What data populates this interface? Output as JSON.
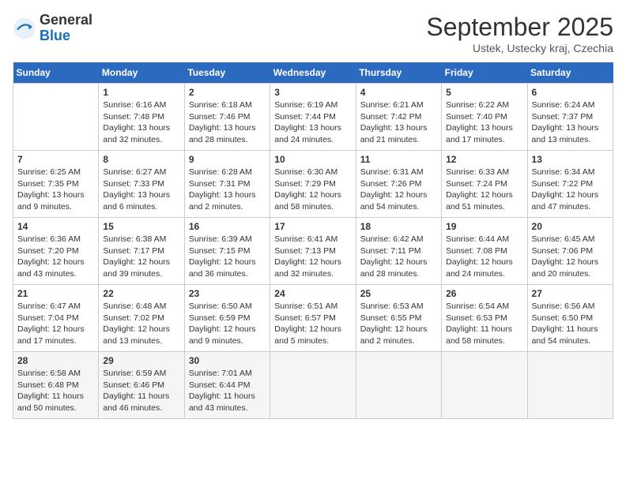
{
  "header": {
    "logo_general": "General",
    "logo_blue": "Blue",
    "month_title": "September 2025",
    "location": "Ustek, Ustecky kraj, Czechia"
  },
  "days_of_week": [
    "Sunday",
    "Monday",
    "Tuesday",
    "Wednesday",
    "Thursday",
    "Friday",
    "Saturday"
  ],
  "weeks": [
    [
      {
        "day": "",
        "info": ""
      },
      {
        "day": "1",
        "info": "Sunrise: 6:16 AM\nSunset: 7:48 PM\nDaylight: 13 hours\nand 32 minutes."
      },
      {
        "day": "2",
        "info": "Sunrise: 6:18 AM\nSunset: 7:46 PM\nDaylight: 13 hours\nand 28 minutes."
      },
      {
        "day": "3",
        "info": "Sunrise: 6:19 AM\nSunset: 7:44 PM\nDaylight: 13 hours\nand 24 minutes."
      },
      {
        "day": "4",
        "info": "Sunrise: 6:21 AM\nSunset: 7:42 PM\nDaylight: 13 hours\nand 21 minutes."
      },
      {
        "day": "5",
        "info": "Sunrise: 6:22 AM\nSunset: 7:40 PM\nDaylight: 13 hours\nand 17 minutes."
      },
      {
        "day": "6",
        "info": "Sunrise: 6:24 AM\nSunset: 7:37 PM\nDaylight: 13 hours\nand 13 minutes."
      }
    ],
    [
      {
        "day": "7",
        "info": "Sunrise: 6:25 AM\nSunset: 7:35 PM\nDaylight: 13 hours\nand 9 minutes."
      },
      {
        "day": "8",
        "info": "Sunrise: 6:27 AM\nSunset: 7:33 PM\nDaylight: 13 hours\nand 6 minutes."
      },
      {
        "day": "9",
        "info": "Sunrise: 6:28 AM\nSunset: 7:31 PM\nDaylight: 13 hours\nand 2 minutes."
      },
      {
        "day": "10",
        "info": "Sunrise: 6:30 AM\nSunset: 7:29 PM\nDaylight: 12 hours\nand 58 minutes."
      },
      {
        "day": "11",
        "info": "Sunrise: 6:31 AM\nSunset: 7:26 PM\nDaylight: 12 hours\nand 54 minutes."
      },
      {
        "day": "12",
        "info": "Sunrise: 6:33 AM\nSunset: 7:24 PM\nDaylight: 12 hours\nand 51 minutes."
      },
      {
        "day": "13",
        "info": "Sunrise: 6:34 AM\nSunset: 7:22 PM\nDaylight: 12 hours\nand 47 minutes."
      }
    ],
    [
      {
        "day": "14",
        "info": "Sunrise: 6:36 AM\nSunset: 7:20 PM\nDaylight: 12 hours\nand 43 minutes."
      },
      {
        "day": "15",
        "info": "Sunrise: 6:38 AM\nSunset: 7:17 PM\nDaylight: 12 hours\nand 39 minutes."
      },
      {
        "day": "16",
        "info": "Sunrise: 6:39 AM\nSunset: 7:15 PM\nDaylight: 12 hours\nand 36 minutes."
      },
      {
        "day": "17",
        "info": "Sunrise: 6:41 AM\nSunset: 7:13 PM\nDaylight: 12 hours\nand 32 minutes."
      },
      {
        "day": "18",
        "info": "Sunrise: 6:42 AM\nSunset: 7:11 PM\nDaylight: 12 hours\nand 28 minutes."
      },
      {
        "day": "19",
        "info": "Sunrise: 6:44 AM\nSunset: 7:08 PM\nDaylight: 12 hours\nand 24 minutes."
      },
      {
        "day": "20",
        "info": "Sunrise: 6:45 AM\nSunset: 7:06 PM\nDaylight: 12 hours\nand 20 minutes."
      }
    ],
    [
      {
        "day": "21",
        "info": "Sunrise: 6:47 AM\nSunset: 7:04 PM\nDaylight: 12 hours\nand 17 minutes."
      },
      {
        "day": "22",
        "info": "Sunrise: 6:48 AM\nSunset: 7:02 PM\nDaylight: 12 hours\nand 13 minutes."
      },
      {
        "day": "23",
        "info": "Sunrise: 6:50 AM\nSunset: 6:59 PM\nDaylight: 12 hours\nand 9 minutes."
      },
      {
        "day": "24",
        "info": "Sunrise: 6:51 AM\nSunset: 6:57 PM\nDaylight: 12 hours\nand 5 minutes."
      },
      {
        "day": "25",
        "info": "Sunrise: 6:53 AM\nSunset: 6:55 PM\nDaylight: 12 hours\nand 2 minutes."
      },
      {
        "day": "26",
        "info": "Sunrise: 6:54 AM\nSunset: 6:53 PM\nDaylight: 11 hours\nand 58 minutes."
      },
      {
        "day": "27",
        "info": "Sunrise: 6:56 AM\nSunset: 6:50 PM\nDaylight: 11 hours\nand 54 minutes."
      }
    ],
    [
      {
        "day": "28",
        "info": "Sunrise: 6:58 AM\nSunset: 6:48 PM\nDaylight: 11 hours\nand 50 minutes."
      },
      {
        "day": "29",
        "info": "Sunrise: 6:59 AM\nSunset: 6:46 PM\nDaylight: 11 hours\nand 46 minutes."
      },
      {
        "day": "30",
        "info": "Sunrise: 7:01 AM\nSunset: 6:44 PM\nDaylight: 11 hours\nand 43 minutes."
      },
      {
        "day": "",
        "info": ""
      },
      {
        "day": "",
        "info": ""
      },
      {
        "day": "",
        "info": ""
      },
      {
        "day": "",
        "info": ""
      }
    ]
  ]
}
